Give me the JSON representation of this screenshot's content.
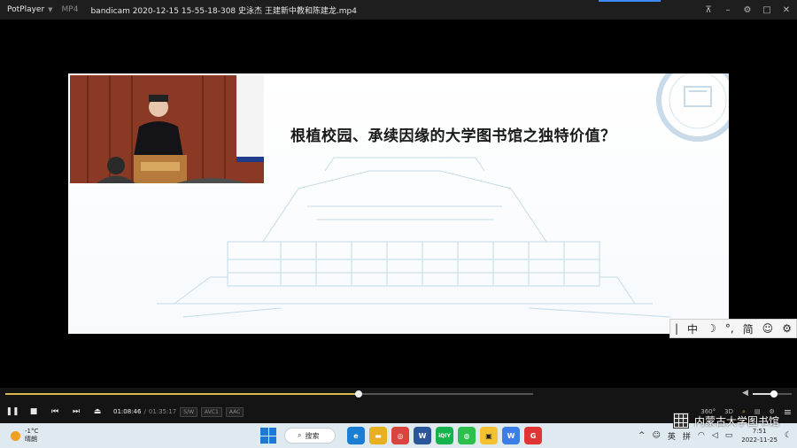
{
  "titlebar": {
    "app_name": "PotPlayer",
    "format": "MP4",
    "file_name": "bandicam 2020-12-15 15-55-18-308 史泳杰 王建新中教和陈建龙.mp4",
    "buttons": {
      "pin": "⊼",
      "minimize": "–",
      "settings": "⚙",
      "maximize": "□",
      "close": "✕"
    }
  },
  "slide": {
    "title": "根植校园、承续因缘的大学图书馆之独特价值？"
  },
  "ime": {
    "items": [
      "|",
      "中",
      "☽",
      "°,",
      "简",
      "☺",
      "⚙"
    ]
  },
  "playback": {
    "progress": 0.67,
    "volume": 0.55,
    "current_time": "01:08:46",
    "separator": "/",
    "total_time": "01:35:17",
    "tags": [
      "S/W",
      "AVC1",
      "AAC"
    ],
    "right_labels": {
      "r360": "360°",
      "r3d": "3D"
    }
  },
  "watermark": {
    "text": "内蒙古大学图书馆"
  },
  "taskbar": {
    "weather_temp": "-1°C",
    "weather_desc": "晴朗",
    "search_label": "搜索",
    "apps": [
      {
        "name": "edge",
        "label": "e",
        "color": "#1a7fd4"
      },
      {
        "name": "folder",
        "label": "▬",
        "color": "#e8b020"
      },
      {
        "name": "chrome",
        "label": "◎",
        "color": "#d9443c"
      },
      {
        "name": "word",
        "label": "W",
        "color": "#2b579a"
      },
      {
        "name": "iqiyi",
        "label": "iQIY",
        "color": "#15b34b"
      },
      {
        "name": "wechat",
        "label": "◍",
        "color": "#2dbf4c"
      },
      {
        "name": "bandicam",
        "label": "▣",
        "color": "#f2c230"
      },
      {
        "name": "wps",
        "label": "W",
        "color": "#3b7ee8"
      },
      {
        "name": "app-red",
        "label": "G",
        "color": "#e03535"
      }
    ],
    "tray": {
      "chevron": "^",
      "lang_en": "英",
      "lang_pinyin": "拼",
      "time": "7:51",
      "date": "2022-11-25"
    }
  }
}
